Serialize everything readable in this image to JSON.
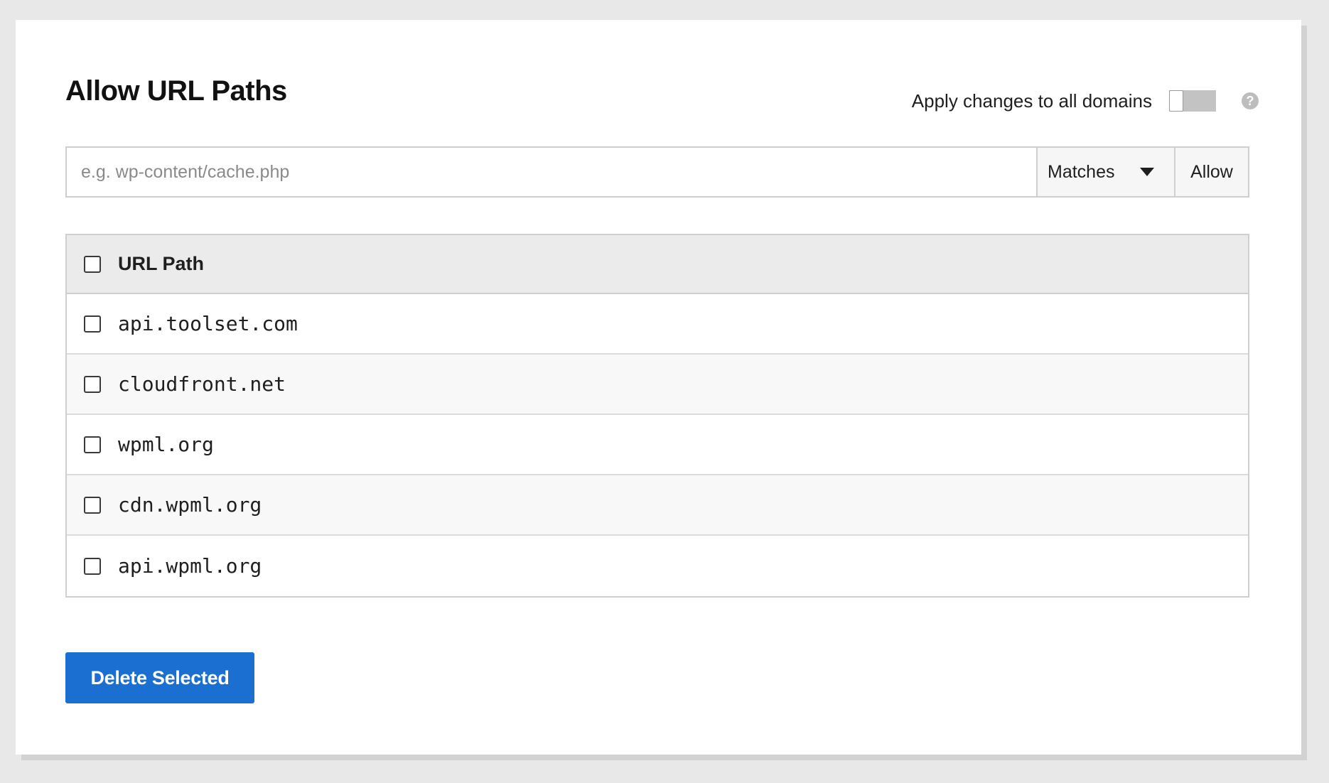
{
  "header": {
    "title": "Allow URL Paths",
    "apply_all_label": "Apply changes to all domains",
    "apply_all_enabled": false,
    "help_glyph": "?"
  },
  "form": {
    "placeholder": "e.g. wp-content/cache.php",
    "value": "",
    "match_selected": "Matches",
    "allow_label": "Allow"
  },
  "table": {
    "header_label": "URL Path",
    "rows": [
      {
        "path": "api.toolset.com",
        "checked": false
      },
      {
        "path": "cloudfront.net",
        "checked": false
      },
      {
        "path": "wpml.org",
        "checked": false
      },
      {
        "path": "cdn.wpml.org",
        "checked": false
      },
      {
        "path": "api.wpml.org",
        "checked": false
      }
    ]
  },
  "actions": {
    "delete_label": "Delete Selected"
  },
  "colors": {
    "primary": "#1b6fd1",
    "toggle_off": "#c3c3c3",
    "table_header_bg": "#ebebeb"
  },
  "icons": {
    "help": "help-circle-icon",
    "caret": "caret-down-icon"
  }
}
